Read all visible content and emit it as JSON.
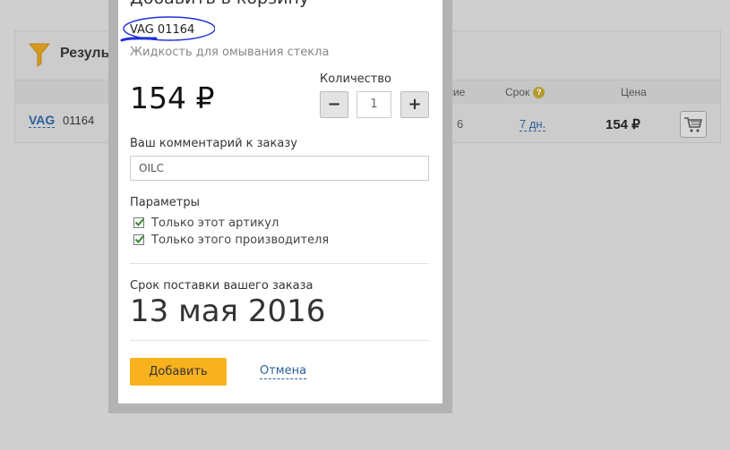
{
  "background": {
    "results_title": "Результ",
    "columns": {
      "stock": "ичие",
      "term": "Срок",
      "term_help": "?",
      "price": "Цена"
    },
    "row": {
      "brand": "VAG",
      "article": "01164",
      "stock": "6",
      "term": "7 дн.",
      "price": "154 ₽"
    }
  },
  "modal": {
    "title": "Добавить в корзину",
    "product_code": "VAG 01164",
    "product_description": "Жидкость для омывания стекла",
    "price": "154 ₽",
    "quantity": {
      "label": "Количество",
      "minus": "−",
      "value": "1",
      "plus": "+"
    },
    "comment": {
      "label": "Ваш комментарий к заказу",
      "value": "OILC"
    },
    "params": {
      "label": "Параметры",
      "options": [
        {
          "label": "Только этот артикул",
          "checked": true
        },
        {
          "label": "Только этого производителя",
          "checked": true
        }
      ]
    },
    "delivery": {
      "label": "Срок поставки вашего заказа",
      "date": "13 мая 2016"
    },
    "add_button": "Добавить",
    "cancel_link": "Отмена"
  },
  "colors": {
    "accent": "#f7b21e",
    "link": "#2b5f9a",
    "check": "#2e8b2e",
    "annotation": "#1f2fd6"
  }
}
